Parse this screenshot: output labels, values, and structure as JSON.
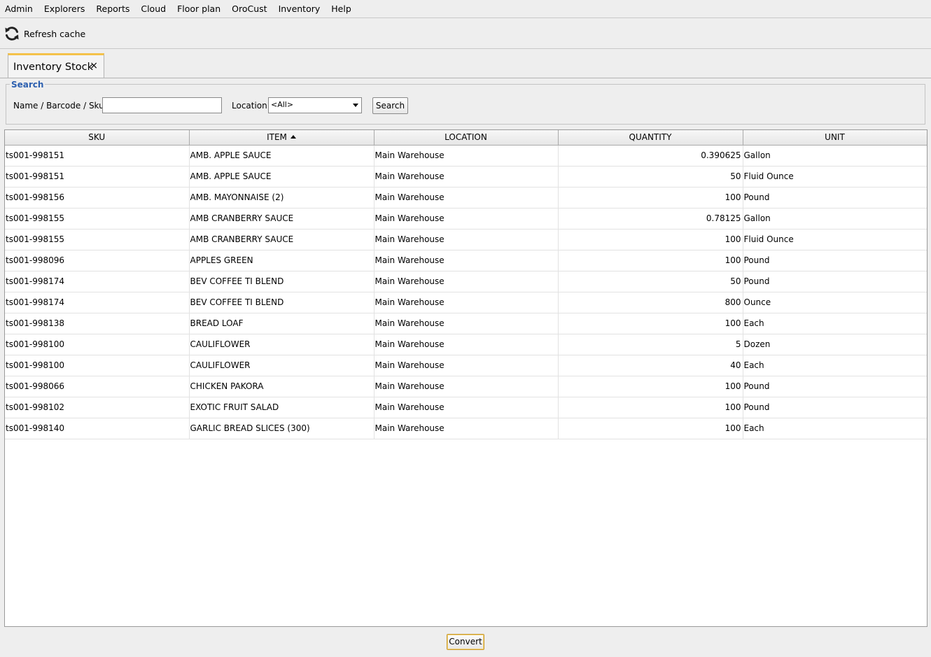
{
  "menu": [
    "Admin",
    "Explorers",
    "Reports",
    "Cloud",
    "Floor plan",
    "OroCust",
    "Inventory",
    "Help"
  ],
  "toolbar": {
    "refresh_label": "Refresh cache"
  },
  "tab": {
    "title": "Inventory Stock",
    "close": "×"
  },
  "search": {
    "legend": "Search",
    "name_label": "Name / Barcode / Sku:",
    "name_value": "",
    "location_label": "Location",
    "location_value": "<All>",
    "button": "Search"
  },
  "table": {
    "columns": [
      "SKU",
      "ITEM",
      "LOCATION",
      "QUANTITY",
      "UNIT"
    ],
    "sorted_column": "ITEM",
    "rows": [
      [
        "ts001-998151",
        "AMB. APPLE SAUCE",
        "Main Warehouse",
        "0.390625",
        "Gallon"
      ],
      [
        "ts001-998151",
        "AMB. APPLE SAUCE",
        "Main Warehouse",
        "50",
        "Fluid Ounce"
      ],
      [
        "ts001-998156",
        "AMB. MAYONNAISE (2)",
        "Main Warehouse",
        "100",
        "Pound"
      ],
      [
        "ts001-998155",
        "AMB CRANBERRY SAUCE",
        "Main Warehouse",
        "0.78125",
        "Gallon"
      ],
      [
        "ts001-998155",
        "AMB CRANBERRY SAUCE",
        "Main Warehouse",
        "100",
        "Fluid Ounce"
      ],
      [
        "ts001-998096",
        "APPLES GREEN",
        "Main Warehouse",
        "100",
        "Pound"
      ],
      [
        "ts001-998174",
        "BEV COFFEE TI BLEND",
        "Main Warehouse",
        "50",
        "Pound"
      ],
      [
        "ts001-998174",
        "BEV COFFEE TI BLEND",
        "Main Warehouse",
        "800",
        "Ounce"
      ],
      [
        "ts001-998138",
        "BREAD LOAF",
        "Main Warehouse",
        "100",
        "Each"
      ],
      [
        "ts001-998100",
        "CAULIFLOWER",
        "Main Warehouse",
        "5",
        "Dozen"
      ],
      [
        "ts001-998100",
        "CAULIFLOWER",
        "Main Warehouse",
        "40",
        "Each"
      ],
      [
        "ts001-998066",
        "CHICKEN PAKORA",
        "Main Warehouse",
        "100",
        "Pound"
      ],
      [
        "ts001-998102",
        "EXOTIC FRUIT SALAD",
        "Main Warehouse",
        "100",
        "Pound"
      ],
      [
        "ts001-998140",
        "GARLIC BREAD SLICES (300)",
        "Main Warehouse",
        "100",
        "Each"
      ]
    ]
  },
  "footer": {
    "convert_label": "Convert"
  },
  "icons": {
    "refresh": "refresh-icon",
    "sort": "sort-ascending-icon",
    "dropdown": "chevron-down-icon"
  },
  "colors": {
    "tab_accent": "#f4c24a",
    "legend": "#2c5faf"
  }
}
